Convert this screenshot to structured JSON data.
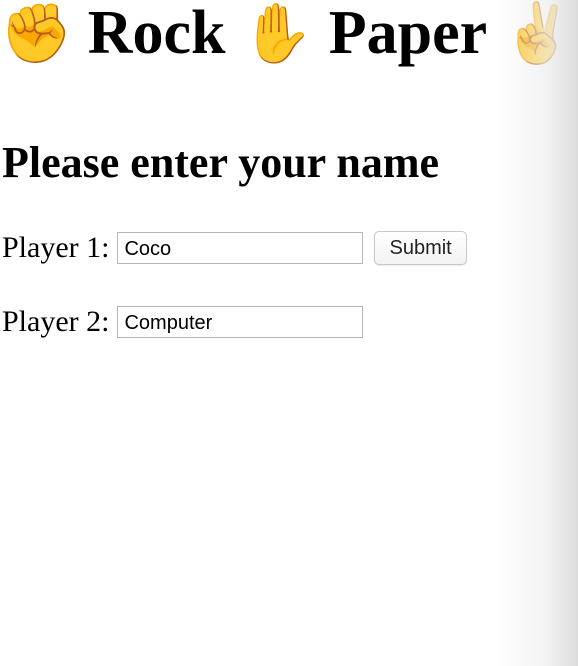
{
  "header": {
    "title_parts": [
      {
        "emoji": "✊",
        "emoji_name": "raised-fist-icon",
        "word": "Rock"
      },
      {
        "emoji": "✋",
        "emoji_name": "raised-hand-icon",
        "word": "Paper"
      },
      {
        "emoji": "✌️",
        "emoji_name": "victory-hand-icon",
        "word": ""
      }
    ]
  },
  "form": {
    "heading": "Please enter your name",
    "player1": {
      "label": "Player 1:",
      "value": "Coco"
    },
    "player2": {
      "label": "Player 2:",
      "value": "Computer"
    },
    "submit_label": "Submit"
  }
}
